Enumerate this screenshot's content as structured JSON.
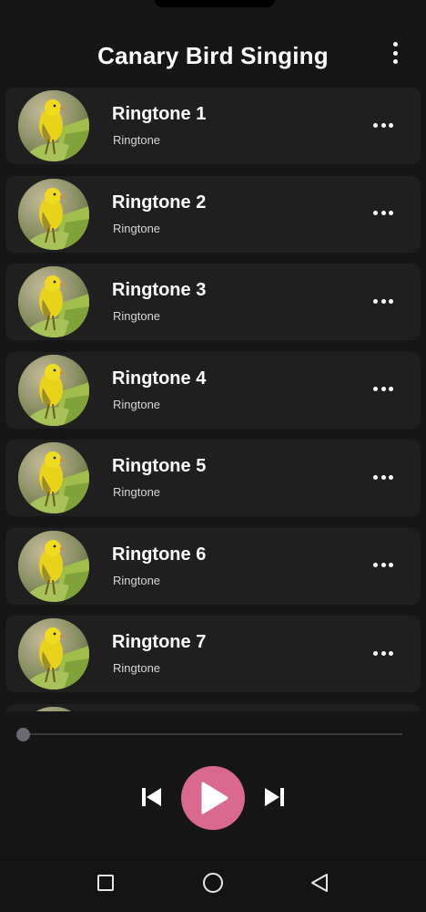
{
  "header": {
    "title": "Canary Bird Singing",
    "menu_icon": "more-vertical-icon"
  },
  "ringtones": [
    {
      "title": "Ringtone 1",
      "subtitle": "Ringtone"
    },
    {
      "title": "Ringtone 2",
      "subtitle": "Ringtone"
    },
    {
      "title": "Ringtone 3",
      "subtitle": "Ringtone"
    },
    {
      "title": "Ringtone 4",
      "subtitle": "Ringtone"
    },
    {
      "title": "Ringtone 5",
      "subtitle": "Ringtone"
    },
    {
      "title": "Ringtone 6",
      "subtitle": "Ringtone"
    },
    {
      "title": "Ringtone 7",
      "subtitle": "Ringtone"
    },
    {
      "title": "",
      "subtitle": ""
    }
  ],
  "player": {
    "progress": 0,
    "prev_icon": "skip-previous-icon",
    "play_icon": "play-icon",
    "next_icon": "skip-next-icon"
  },
  "colors": {
    "background": "#161616",
    "card": "#1f1f1f",
    "accent": "#d9698f",
    "text": "#ffffff"
  },
  "navbar": {
    "recent_icon": "recent-apps-icon",
    "home_icon": "home-icon",
    "back_icon": "back-icon"
  }
}
